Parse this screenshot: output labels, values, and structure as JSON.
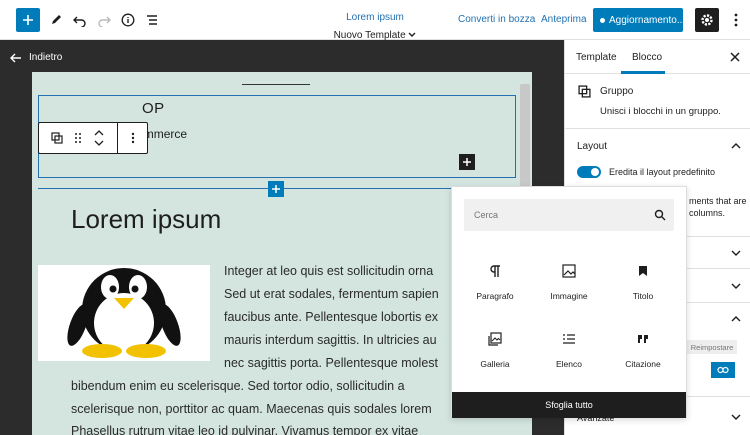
{
  "topbar": {
    "title": "Lorem ipsum",
    "template_label": "Nuovo Template",
    "save_draft": "Converti in bozza",
    "preview": "Anteprima",
    "update": "Aggiornamento..."
  },
  "editor": {
    "back_label": "Indietro",
    "shop_fragment": "OP",
    "tagline": "The new e-commerce",
    "heading": "Lorem ipsum",
    "paragraph_lines": [
      "Integer at leo quis est sollicitudin orna",
      "Sed ut erat sodales, fermentum sapien",
      "faucibus ante. Pellentesque lobortis ex",
      "mauris interdum sagittis. In ultricies au",
      "nec sagittis porta. Pellentesque molest",
      "bibendum enim eu scelerisque. Sed tortor odio, sollicitudin a",
      "scelerisque non, porttitor ac quam. Maecenas quis sodales lorem",
      "Phasellus rutrum vitae leo id pulvinar. Vivamus tempor ex vitae"
    ]
  },
  "sidebar": {
    "tab_template": "Template",
    "tab_block": "Blocco",
    "block_title": "Gruppo",
    "block_description": "Unisci i blocchi in un gruppo.",
    "layout_title": "Layout",
    "inherit_layout": "Eredita il layout predefinito",
    "partial_line1": "ments that are",
    "partial_line2": "columns.",
    "reset": "Reimpostare",
    "advanced_partial": "Avanzate"
  },
  "inserter": {
    "search_placeholder": "Cerca",
    "blocks": [
      {
        "label": "Paragrafo",
        "icon": "paragraph-icon"
      },
      {
        "label": "Immagine",
        "icon": "image-icon"
      },
      {
        "label": "Titolo",
        "icon": "bookmark-icon"
      },
      {
        "label": "Galleria",
        "icon": "gallery-icon"
      },
      {
        "label": "Elenco",
        "icon": "list-icon"
      },
      {
        "label": "Citazione",
        "icon": "quote-icon"
      }
    ],
    "browse_all": "Sfoglia tutto"
  },
  "colors": {
    "accent": "#007cba",
    "canvas_bg": "#d4e5e0",
    "dark_bg": "#2c2c2c"
  }
}
